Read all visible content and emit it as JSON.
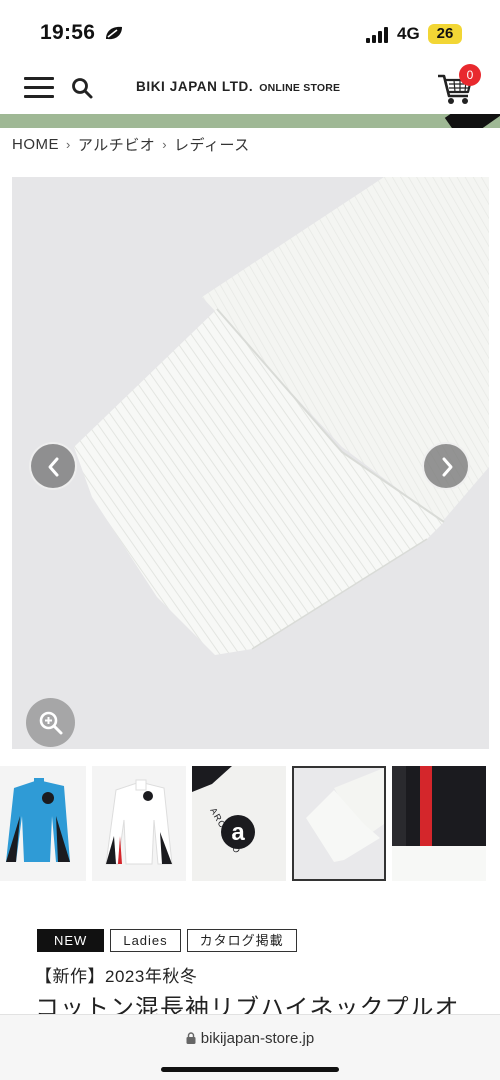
{
  "status_bar": {
    "time": "19:56",
    "network": "4G",
    "battery": "26"
  },
  "header": {
    "brand": "BIKI JAPAN LTD.",
    "brand_sub": "ONLINE STORE",
    "cart_count": "0",
    "icons": [
      "menu-icon",
      "search-icon",
      "cart-icon"
    ]
  },
  "breadcrumb": {
    "items": [
      "HOME",
      "アルチビオ",
      "レディース"
    ],
    "separator": "›"
  },
  "gallery": {
    "thumbnail_count": 5,
    "active_index": 3,
    "thumb_logo_text": "ARCHIVIO",
    "thumb_logo_letter": "a",
    "accent_colors": {
      "blue": "#2f9bd6",
      "red": "#d4262b",
      "black": "#1b1b1f"
    }
  },
  "product": {
    "tags": [
      "NEW",
      "Ladies",
      "カタログ掲載"
    ],
    "subtitle": "【新作】2023年秋冬",
    "title": "コットン混長袖リブハイネックプルオ"
  },
  "browser": {
    "url": "bikijapan-store.jp"
  }
}
